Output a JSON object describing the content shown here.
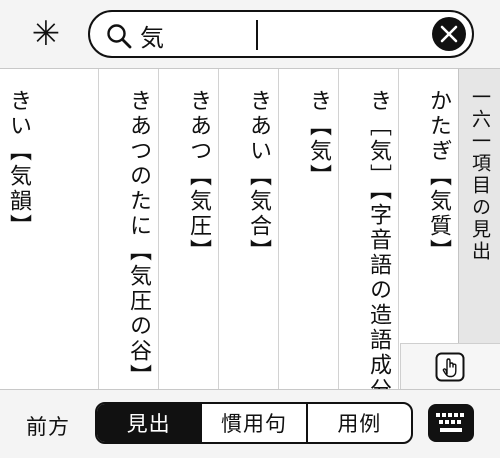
{
  "header": {
    "asterisk_icon": "asterisk-icon",
    "search": {
      "value": "気",
      "search_icon": "search-icon",
      "clear_icon": "clear-x-icon"
    }
  },
  "results": [
    {
      "label": "かたぎ【気質】"
    },
    {
      "label": "き［気］【字音語の造語成分】"
    },
    {
      "label": "き【気】"
    },
    {
      "label": "きあい【気合】"
    },
    {
      "label": "きあつ【気圧】"
    },
    {
      "label": "きあつのたに【気圧の谷】"
    },
    {
      "label": "きい【気韻】"
    }
  ],
  "side": {
    "heading": "一六一項目の見出",
    "hand_icon": "hand-pointer-icon"
  },
  "footer": {
    "prefix": "前方",
    "tabs": [
      {
        "label": "見出",
        "active": true
      },
      {
        "label": "慣用句",
        "active": false
      },
      {
        "label": "用例",
        "active": false
      }
    ],
    "keyboard_icon": "keyboard-icon"
  }
}
